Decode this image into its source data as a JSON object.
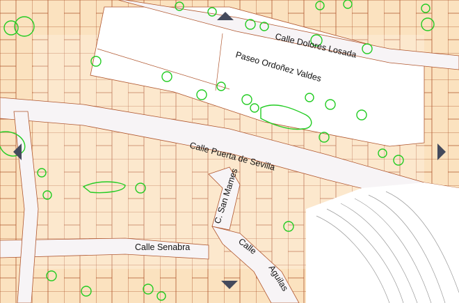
{
  "map": {
    "streets": {
      "dolores": "Calle Dolores Losada",
      "paseo": "Paseo Ordoñez Valdes",
      "puerta": "Calle Puerta de Sevilla",
      "sanmames": "C. San Mames",
      "senabra": "Calle Senabra",
      "aguilas1": "Calle",
      "aguilas2": "Aguilas"
    },
    "colors": {
      "building_fill": "#fbe2bf",
      "building_stroke": "#b0562e",
      "street": "#f7f4f6",
      "tree": "#22cc22",
      "contour": "#9a9a9a",
      "nav_arrow": "#444a5c"
    },
    "icons": {
      "pan_up": "triangle-up-icon",
      "pan_down": "triangle-down-icon",
      "pan_left": "triangle-left-icon",
      "pan_right": "triangle-right-icon"
    }
  }
}
